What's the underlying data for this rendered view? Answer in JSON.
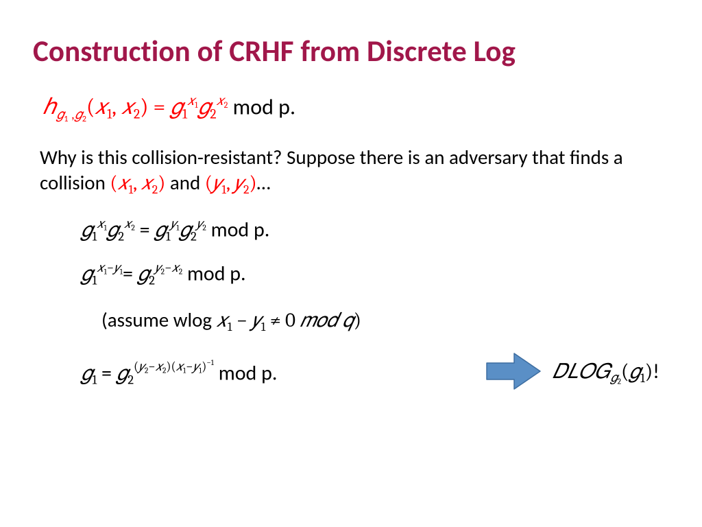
{
  "title": "Construction of CRHF from Discrete Log",
  "eq1": {
    "h": "ℎ",
    "g1lbl": "𝑔",
    "one": "1",
    "comma_s": " ,",
    "g2lbl": "𝑔",
    "two": "2",
    "lp": "(",
    "x": "𝑥",
    "c": ",",
    "rp": ") = ",
    "modp": " mod p."
  },
  "para": {
    "t1": "Why is this collision-resistant? Suppose there is an adversary that finds a collision ",
    "lp1": "(",
    "x": "𝑥",
    "one": "1",
    "c": ",",
    "two": "2",
    "rp1": ")",
    "and": " and ",
    "y": "𝑦",
    "ell": "…"
  },
  "eq2": {
    "g": "𝑔",
    "one": "1",
    "two": "2",
    "x": "𝑥",
    "y": "𝑦",
    "eq": " = ",
    "modp": " mod p."
  },
  "eq3": {
    "g": "𝑔",
    "one": "1",
    "two": "2",
    "x": "𝑥",
    "y": "𝑦",
    "minus": "−",
    "eq": "= ",
    "modp": " mod p."
  },
  "eq4": {
    "open": "(assume wlog ",
    "x": "𝑥",
    "one": "1",
    "minus": " − ",
    "y": "𝑦",
    "neq": " ≠ 0 ",
    "mod": "𝑚𝑜𝑑 𝑞",
    "close": ")"
  },
  "eq5": {
    "g": "𝑔",
    "one": "1",
    "two": "2",
    "eq": " = ",
    "lp": "(",
    "y": "𝑦",
    "minus": "−",
    "x": "𝑥",
    "rp": ")",
    "inv": "−1",
    "modp": " mod p."
  },
  "dlog": {
    "D": "𝐷𝐿𝑂𝐺",
    "g": "𝑔",
    "two": "2",
    "lp": "(",
    "one": "1",
    "rp": ")",
    "bang": "!"
  }
}
